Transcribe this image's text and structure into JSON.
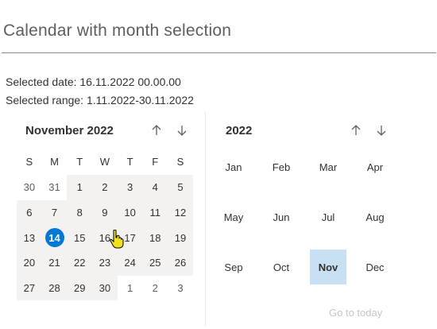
{
  "page": {
    "title": "Calendar with month selection"
  },
  "info": {
    "selected_date": "Selected date: 16.11.2022 00.00.00",
    "selected_range": "Selected range: 1.11.2022-30.11.2022"
  },
  "day_picker": {
    "header": "November 2022",
    "weekdays": [
      "S",
      "M",
      "T",
      "W",
      "T",
      "F",
      "S"
    ],
    "weeks": [
      [
        {
          "d": "30",
          "outside": true,
          "range": false
        },
        {
          "d": "31",
          "outside": true,
          "range": false
        },
        {
          "d": "1",
          "range": true
        },
        {
          "d": "2",
          "range": true
        },
        {
          "d": "3",
          "range": true
        },
        {
          "d": "4",
          "range": true
        },
        {
          "d": "5",
          "range": true
        }
      ],
      [
        {
          "d": "6",
          "range": true
        },
        {
          "d": "7",
          "range": true
        },
        {
          "d": "8",
          "range": true
        },
        {
          "d": "9",
          "range": true
        },
        {
          "d": "10",
          "range": true
        },
        {
          "d": "11",
          "range": true
        },
        {
          "d": "12",
          "range": true
        }
      ],
      [
        {
          "d": "13",
          "range": true
        },
        {
          "d": "14",
          "range": true,
          "today": true
        },
        {
          "d": "15",
          "range": true
        },
        {
          "d": "16",
          "range": true
        },
        {
          "d": "17",
          "range": true
        },
        {
          "d": "18",
          "range": true
        },
        {
          "d": "19",
          "range": true
        }
      ],
      [
        {
          "d": "20",
          "range": true
        },
        {
          "d": "21",
          "range": true
        },
        {
          "d": "22",
          "range": true
        },
        {
          "d": "23",
          "range": true
        },
        {
          "d": "24",
          "range": true
        },
        {
          "d": "25",
          "range": true
        },
        {
          "d": "26",
          "range": true
        }
      ],
      [
        {
          "d": "27",
          "range": true
        },
        {
          "d": "28",
          "range": true
        },
        {
          "d": "29",
          "range": true
        },
        {
          "d": "30",
          "range": true
        },
        {
          "d": "1",
          "outside": true,
          "range": false
        },
        {
          "d": "2",
          "outside": true,
          "range": false
        },
        {
          "d": "3",
          "outside": true,
          "range": false
        }
      ]
    ]
  },
  "month_picker": {
    "year": "2022",
    "months": [
      "Jan",
      "Feb",
      "Mar",
      "Apr",
      "May",
      "Jun",
      "Jul",
      "Aug",
      "Sep",
      "Oct",
      "Nov",
      "Dec"
    ],
    "selected_month": "Nov",
    "go_to_today": "Go to today"
  },
  "colors": {
    "accent": "#0078d4",
    "selected_month_bg": "#c7e0f4",
    "range_bg": "#f3f2f1"
  }
}
